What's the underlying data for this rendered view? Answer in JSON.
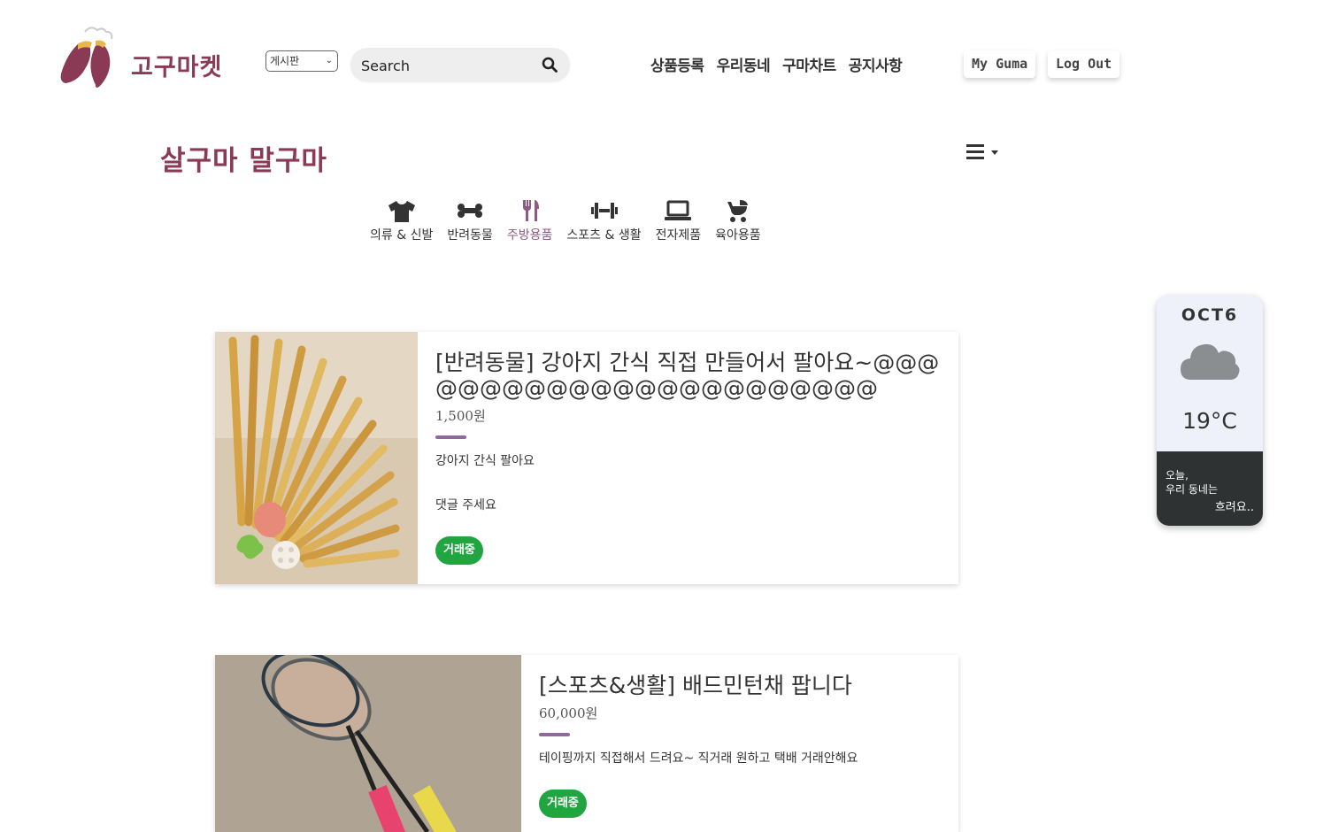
{
  "header": {
    "logo_text": "고구마켓",
    "board_select": "게시판",
    "search": {
      "placeholder": "Search"
    },
    "nav": [
      "상품등록",
      "우리동네",
      "구마차트",
      "공지사항"
    ],
    "my_button": "My Guma",
    "logout_button": "Log Out"
  },
  "page": {
    "title": "살구마 말구마",
    "categories": [
      {
        "label": "의류 & 신발",
        "icon": "shirt-icon"
      },
      {
        "label": "반려동물",
        "icon": "bone-icon"
      },
      {
        "label": "주방용품",
        "icon": "utensils-icon",
        "active": true
      },
      {
        "label": "스포츠 & 생활",
        "icon": "dumbbell-icon"
      },
      {
        "label": "전자제품",
        "icon": "laptop-icon"
      },
      {
        "label": "육아용품",
        "icon": "stroller-icon"
      }
    ]
  },
  "listings": [
    {
      "title": "[반려동물] 강아지 간식 직접 만들어서 팔아요~@@@@@@@@@@@@@@@@@@@@@@@",
      "price": "1,500원",
      "desc": "강아지 간식 팔아요",
      "desc2": "댓글 주세요",
      "status": "거래중"
    },
    {
      "title": "[스포츠&생활] 배드민턴채 팝니다",
      "price": "60,000원",
      "desc": "테이핑까지 직접해서 드려요~  직거래 원하고 택배 거래안해요",
      "status": "거래중"
    }
  ],
  "weather": {
    "date": "OCT6",
    "temp": "19°C",
    "line1": "오늘,",
    "line2": "우리 동네는",
    "line3": "흐려요.."
  },
  "colors": {
    "brand": "#8b3a55",
    "accent": "#8e6a98",
    "status": "#21a541"
  }
}
